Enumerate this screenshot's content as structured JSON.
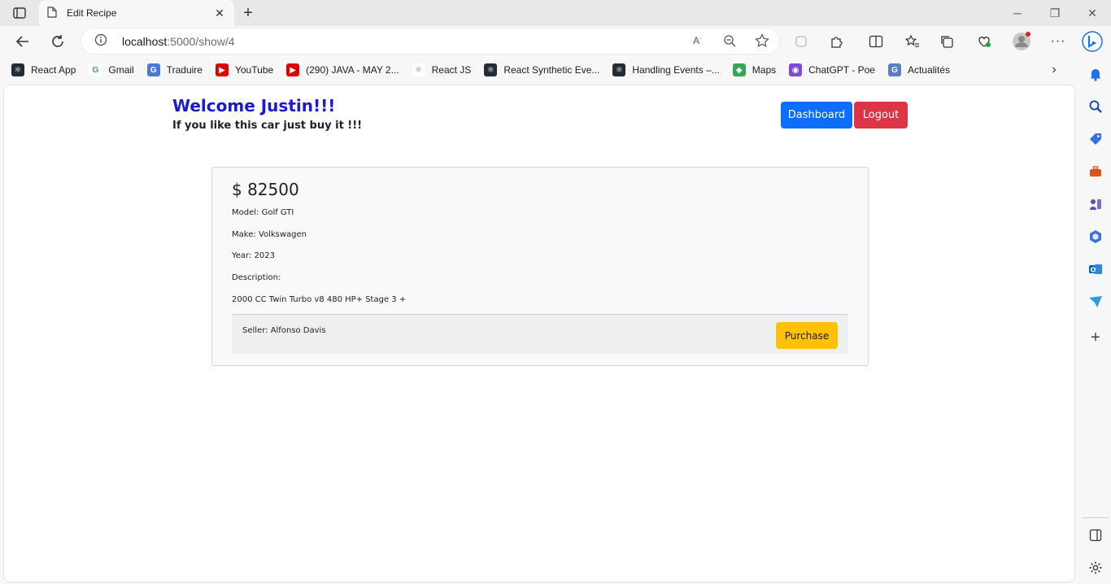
{
  "browser": {
    "tab_title": "Edit Recipe",
    "url_host": "localhost",
    "url_path": ":5000/show/4",
    "bookmarks": [
      {
        "label": "React App",
        "icon": "react-icon",
        "color": "#222c37"
      },
      {
        "label": "Gmail",
        "icon": "google-icon",
        "color": "#4285f4"
      },
      {
        "label": "Traduire",
        "icon": "translate-icon",
        "color": "#4a7ad8"
      },
      {
        "label": "YouTube",
        "icon": "youtube-icon",
        "color": "#e00000"
      },
      {
        "label": "(290) JAVA - MAY 2...",
        "icon": "youtube-icon",
        "color": "#e00000"
      },
      {
        "label": "React JS",
        "icon": "react-icon",
        "color": "#3a8fd0"
      },
      {
        "label": "React Synthetic Eve...",
        "icon": "react-icon",
        "color": "#222c37"
      },
      {
        "label": "Handling Events –...",
        "icon": "react-icon",
        "color": "#222c37"
      },
      {
        "label": "Maps",
        "icon": "maps-icon",
        "color": "#34a853"
      },
      {
        "label": "ChatGPT - Poe",
        "icon": "poe-icon",
        "color": "#7b4bd6"
      },
      {
        "label": "Actualités",
        "icon": "news-icon",
        "color": "#5a7fc9"
      }
    ]
  },
  "header": {
    "welcome": "Welcome Justin!!!",
    "subtitle": "If you like this car just buy it !!!",
    "dashboard_label": "Dashboard",
    "logout_label": "Logout"
  },
  "car": {
    "price": "$ 82500",
    "model": "Model: Golf GTI",
    "make": "Make: Volkswagen",
    "year": "Year: 2023",
    "description_label": "Description:",
    "description": "2000 CC Twin Turbo v8 480 HP+ Stage 3 +",
    "seller": "Seller: Alfonso Davis",
    "purchase_label": "Purchase"
  },
  "colors": {
    "primary": "#0d6efd",
    "danger": "#dc3545",
    "warning": "#ffc107",
    "welcome": "#1a1ad1"
  }
}
